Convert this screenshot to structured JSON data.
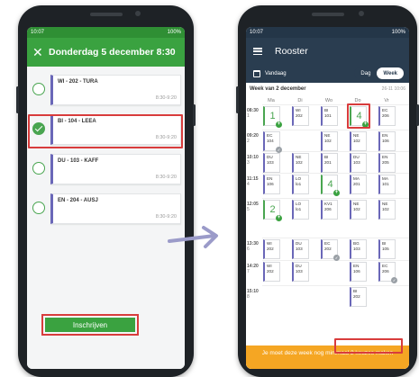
{
  "left_phone": {
    "status": {
      "time": "10:07",
      "right": "100%"
    },
    "header": {
      "close_icon": "close-icon",
      "title": "Donderdag 5 december 8:30"
    },
    "options": [
      {
        "name": "WI - 202 - TURA",
        "time": "8:30-9:20",
        "selected": false
      },
      {
        "name": "BI - 104 - LEEA",
        "time": "8:30-9:20",
        "selected": true
      },
      {
        "name": "DU - 103 - KAFF",
        "time": "8:30-9:20",
        "selected": false
      },
      {
        "name": "EN - 204 - AUSJ",
        "time": "8:30-9:20",
        "selected": false
      }
    ],
    "enroll_button": "Inschrijven"
  },
  "right_phone": {
    "status": {
      "time": "10:07",
      "right": "100%"
    },
    "header": {
      "title": "Rooster"
    },
    "toolbar": {
      "today": "Vandaag",
      "day": "Dag",
      "week": "Week"
    },
    "week_label": "Week van 2 december",
    "week_date": "26-11 10:06",
    "days": [
      "Ma",
      "Di",
      "Wo",
      "Do",
      "Vr"
    ],
    "times": [
      {
        "start": "08:30",
        "num": "1"
      },
      {
        "start": "09:20",
        "num": "2"
      },
      {
        "start": "10:10",
        "num": "3"
      },
      {
        "start": "11:15",
        "num": "4"
      },
      {
        "start": "12:05",
        "num": "5"
      },
      {
        "start": "13:30",
        "num": "6"
      },
      {
        "start": "14:20",
        "num": "7"
      },
      {
        "start": "15:10",
        "num": "8"
      }
    ],
    "lessons": [
      {
        "day": 0,
        "slot": 0,
        "text": "1",
        "big": true,
        "badge": "+"
      },
      {
        "day": 1,
        "slot": 0,
        "text": "WI\n202"
      },
      {
        "day": 2,
        "slot": 0,
        "text": "BI\n101"
      },
      {
        "day": 3,
        "slot": 0,
        "text": "4",
        "big": true,
        "badge": "+",
        "highlight": true
      },
      {
        "day": 4,
        "slot": 0,
        "text": "EC\n206"
      },
      {
        "day": 0,
        "slot": 1,
        "text": "EC\n104",
        "badge": "✓"
      },
      {
        "day": 2,
        "slot": 1,
        "text": "NE\n102"
      },
      {
        "day": 3,
        "slot": 1,
        "text": "NE\n102"
      },
      {
        "day": 4,
        "slot": 1,
        "text": "EN\n106"
      },
      {
        "day": 0,
        "slot": 2,
        "text": "DU\n103"
      },
      {
        "day": 1,
        "slot": 2,
        "text": "NE\n102"
      },
      {
        "day": 2,
        "slot": 2,
        "text": "BI\n201"
      },
      {
        "day": 3,
        "slot": 2,
        "text": "DU\n103"
      },
      {
        "day": 4,
        "slot": 2,
        "text": "EN\n205"
      },
      {
        "day": 0,
        "slot": 3,
        "text": "EN\n106"
      },
      {
        "day": 1,
        "slot": 3,
        "text": "LO\nlo1"
      },
      {
        "day": 2,
        "slot": 3,
        "text": "4",
        "big": true,
        "badge": "+"
      },
      {
        "day": 3,
        "slot": 3,
        "text": "MA\n201"
      },
      {
        "day": 4,
        "slot": 3,
        "text": "MA\n101"
      },
      {
        "day": 0,
        "slot": 4,
        "text": "2",
        "big": true,
        "badge": "+"
      },
      {
        "day": 1,
        "slot": 4,
        "text": "LO\nlo1"
      },
      {
        "day": 2,
        "slot": 4,
        "text": "KV1\n206"
      },
      {
        "day": 3,
        "slot": 4,
        "text": "NE\n102"
      },
      {
        "day": 4,
        "slot": 4,
        "text": "NE\n102"
      },
      {
        "day": 0,
        "slot": 5,
        "text": "WI\n202"
      },
      {
        "day": 1,
        "slot": 5,
        "text": "DU\n103"
      },
      {
        "day": 2,
        "slot": 5,
        "text": "EC\n202",
        "badge": "✓"
      },
      {
        "day": 3,
        "slot": 5,
        "text": "BG\n103"
      },
      {
        "day": 4,
        "slot": 5,
        "text": "BI\n105"
      },
      {
        "day": 0,
        "slot": 6,
        "text": "WI\n202"
      },
      {
        "day": 1,
        "slot": 6,
        "text": "DU\n103"
      },
      {
        "day": 3,
        "slot": 6,
        "text": "EN\n106"
      },
      {
        "day": 4,
        "slot": 6,
        "text": "EC\n206",
        "badge": "✓"
      },
      {
        "day": 3,
        "slot": 7,
        "text": "BI\n202"
      }
    ],
    "banner": {
      "text": "Je moet deze week nog minimaal 2 keuzes maken"
    }
  },
  "colors": {
    "green": "#3aa240",
    "navy": "#2a3d50",
    "orange": "#f5a623",
    "highlight": "#d83c3c",
    "lesson_accent": "#6a67b8"
  }
}
